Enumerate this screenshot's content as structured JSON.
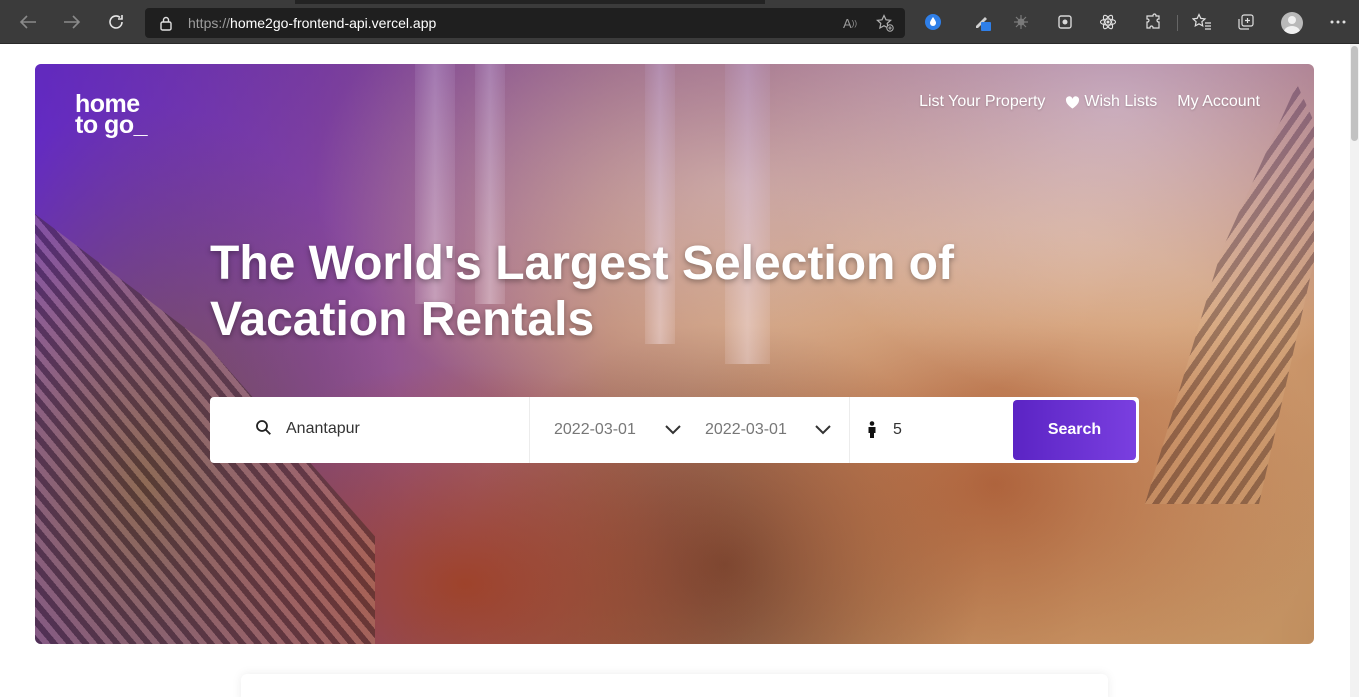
{
  "browser": {
    "url_protocol": "https://",
    "url_host": "home2go-frontend-api.vercel.app",
    "read_aloud_glyph": "A",
    "icons": [
      "back-icon",
      "forward-icon",
      "refresh-icon",
      "lock-icon",
      "read-aloud-icon",
      "add-favorite-icon",
      "extensions-icon",
      "favorites-icon",
      "collections-icon",
      "profile-icon",
      "more-icon"
    ]
  },
  "header": {
    "logo_line1": "home",
    "logo_line2": "to go_",
    "nav": {
      "list_property": "List Your Property",
      "wish_lists": "Wish Lists",
      "my_account": "My Account"
    }
  },
  "hero": {
    "title_line1": "The World's Largest Selection of",
    "title_line2": "Vacation Rentals"
  },
  "search": {
    "location": "Anantapur",
    "check_in": "2022-03-01",
    "check_out": "2022-03-01",
    "guests": "5",
    "button_label": "Search"
  },
  "colors": {
    "accent": "#6a2fd6",
    "chrome_bg": "#3b3b3b",
    "address_bg": "#1f1f1f"
  }
}
